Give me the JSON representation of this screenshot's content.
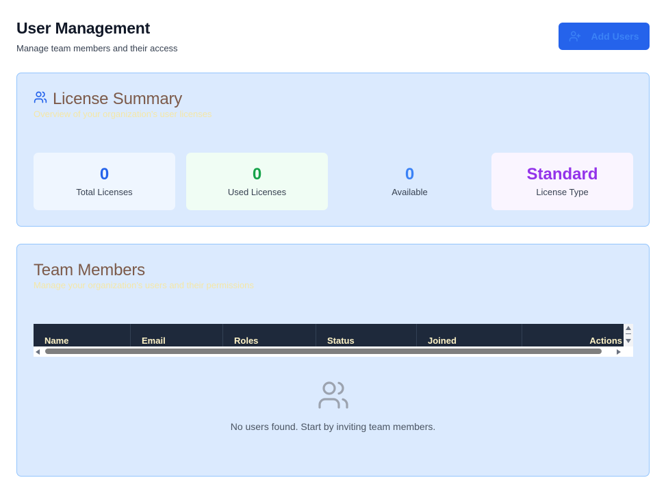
{
  "header": {
    "title": "User Management",
    "subtitle": "Manage team members and their access",
    "add_button_label": "Add Users",
    "add_button_icon": "user-plus-icon"
  },
  "license_summary": {
    "icon": "users-icon",
    "title": "License Summary",
    "description": "Overview of your organization's user licenses",
    "stats": [
      {
        "value": "0",
        "label": "Total Licenses",
        "color": "#2563eb"
      },
      {
        "value": "0",
        "label": "Used Licenses",
        "color": "#16a34a"
      },
      {
        "value": "0",
        "label": "Available",
        "color": "#3b82f6"
      },
      {
        "value": "Standard",
        "label": "License Type",
        "color": "#9333ea"
      }
    ]
  },
  "team_members": {
    "title": "Team Members",
    "description": "Manage your organization's users and their permissions",
    "columns": [
      "Name",
      "Email",
      "Roles",
      "Status",
      "Joined",
      "Actions"
    ],
    "empty_icon": "users-icon",
    "empty_message": "No users found. Start by inviting team members."
  },
  "colors": {
    "primary": "#2563eb",
    "card_background": "#dbeafe",
    "card_border": "#93c5fd",
    "table_header": "#1e293b"
  }
}
